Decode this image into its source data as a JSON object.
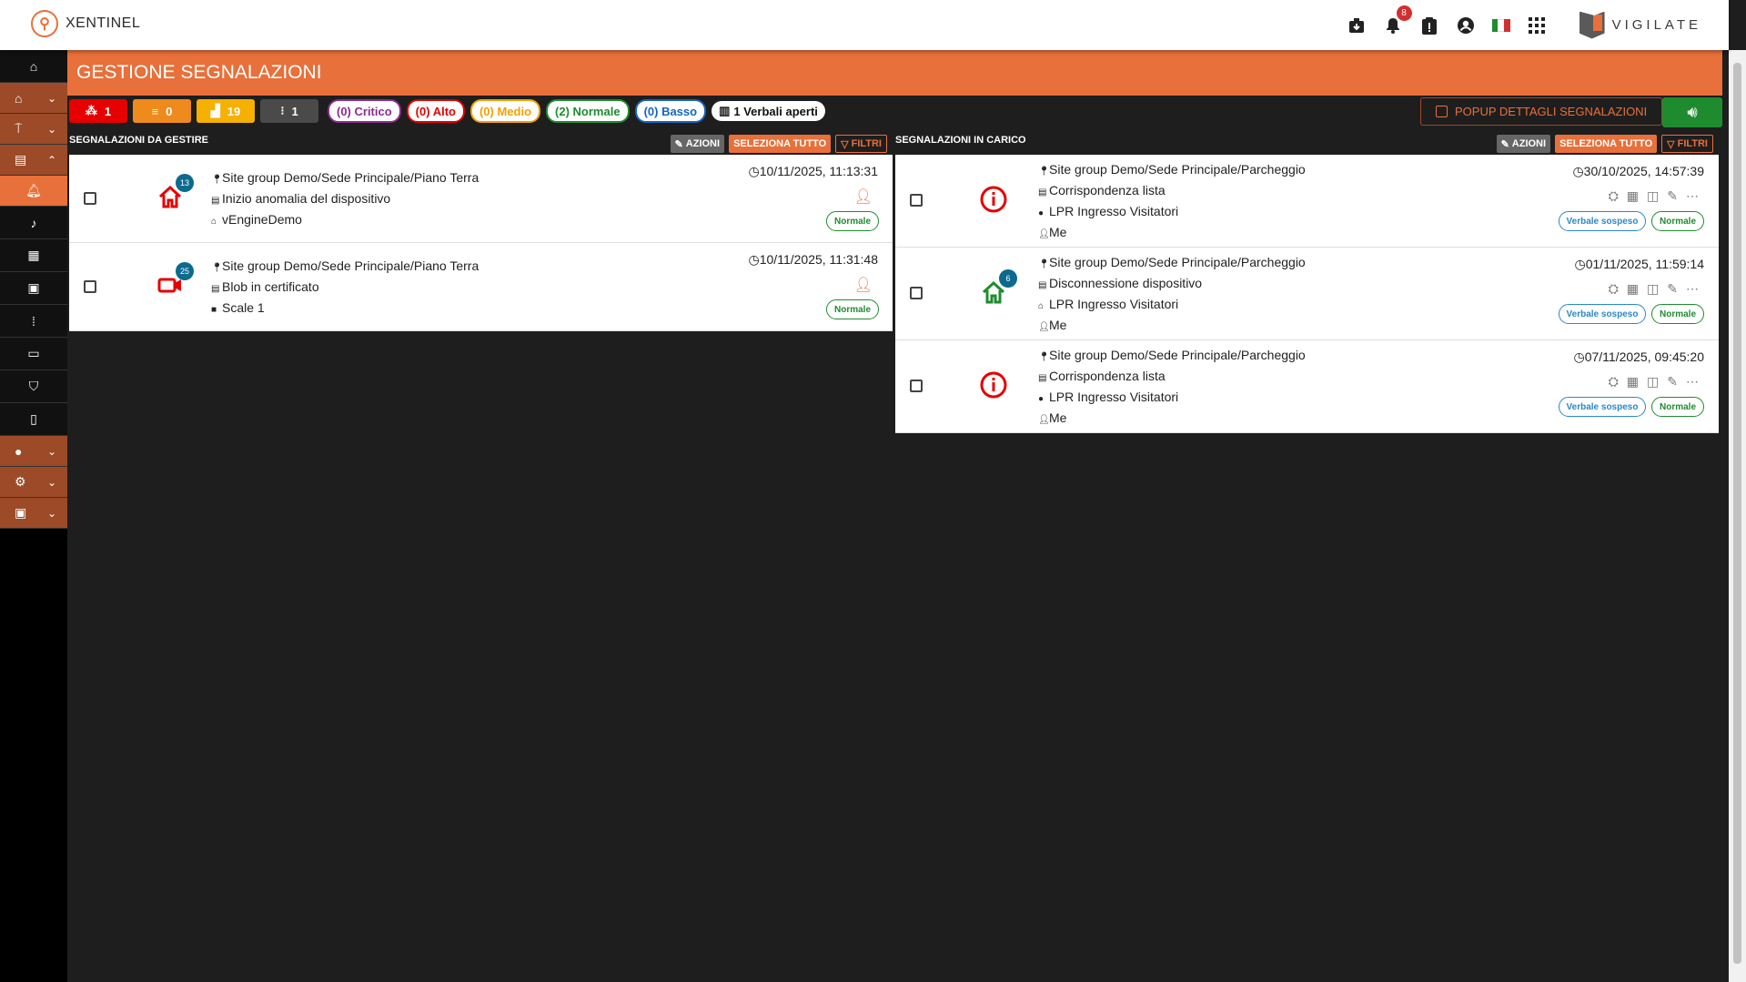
{
  "app": {
    "name": "XENTINEL",
    "brand": "VIGILATE"
  },
  "topbar": {
    "notifications_count": "8",
    "icons": [
      "download-box-icon",
      "bell-icon",
      "alert-clipboard-icon",
      "account-circle-icon",
      "italy-flag-icon",
      "apps-grid-icon"
    ]
  },
  "sidebar": {
    "items": [
      "home-icon",
      "site-icon",
      "antenna-icon",
      "report-icon",
      "alarm-icon",
      "bell-icon",
      "document-icon",
      "lpr-icon",
      "grid-icon",
      "camera-box-icon",
      "shield-icon",
      "file-search-icon",
      "toggle-icon",
      "settings-icon",
      "toolbox-icon"
    ]
  },
  "page": {
    "title": "GESTIONE SEGNALAZIONI"
  },
  "counters": [
    {
      "value": "1",
      "color": "#e60000",
      "icon": "network-icon"
    },
    {
      "value": "0",
      "color": "#ef8a1c",
      "icon": "server-icon"
    },
    {
      "value": "19",
      "color": "#f5b000",
      "icon": "signal-icon"
    },
    {
      "value": "1",
      "color": "#4a4a4a",
      "icon": "unknown-icon"
    }
  ],
  "priorities": [
    {
      "label": "(0) Critico",
      "color": "#8e2b8e"
    },
    {
      "label": "(0) Alto",
      "color": "#e60000"
    },
    {
      "label": "(0) Medio",
      "color": "#f5a000"
    },
    {
      "label": "(2) Normale",
      "color": "#1e8c2e"
    },
    {
      "label": "(0) Basso",
      "color": "#1565c0"
    }
  ],
  "verbali": {
    "label": "1 Verbali aperti"
  },
  "popup_details": {
    "label": "POPUP DETTAGLI SEGNALAZIONI"
  },
  "left_column": {
    "title": "SEGNALAZIONI DA GESTIRE",
    "buttons": {
      "azioni": "AZIONI",
      "seleziona": "SELEZIONA TUTTO",
      "filtri": "FILTRI"
    },
    "cards": [
      {
        "icon": "home-alert-icon",
        "badge": "13",
        "location": "Site group Demo/Sede Principale/Piano Terra",
        "description": "Inizio anomalia del dispositivo",
        "source": "vEngineDemo",
        "timestamp": "10/11/2025, 11:13:31",
        "priority": "Normale"
      },
      {
        "icon": "video-camera-icon",
        "badge": "25",
        "location": "Site group Demo/Sede Principale/Piano Terra",
        "description": "Blob in certificato",
        "source": "Scale 1",
        "timestamp": "10/11/2025, 11:31:48",
        "priority": "Normale"
      }
    ]
  },
  "right_column": {
    "title": "SEGNALAZIONI IN CARICO",
    "buttons": {
      "azioni": "AZIONI",
      "seleziona": "SELEZIONA TUTTO",
      "filtri": "FILTRI"
    },
    "cards": [
      {
        "icon": "info-circle-icon",
        "badge": "",
        "location": "Site group Demo/Sede Principale/Parcheggio",
        "description": "Corrispondenza lista",
        "source": "LPR Ingresso Visitatori",
        "user": "Me",
        "timestamp": "30/10/2025, 14:57:39",
        "status": "Verbale sospeso",
        "priority": "Normale"
      },
      {
        "icon": "home-icon",
        "badge": "6",
        "location": "Site group Demo/Sede Principale/Parcheggio",
        "description": "Disconnessione dispositivo",
        "source": "LPR Ingresso Visitatori",
        "user": "Me",
        "timestamp": "01/11/2025, 11:59:14",
        "status": "Verbale sospeso",
        "priority": "Normale"
      },
      {
        "icon": "info-circle-icon",
        "badge": "",
        "location": "Site group Demo/Sede Principale/Parcheggio",
        "description": "Corrispondenza lista",
        "source": "LPR Ingresso Visitatori",
        "user": "Me",
        "timestamp": "07/11/2025, 09:45:20",
        "status": "Verbale sospeso",
        "priority": "Normale"
      }
    ]
  }
}
